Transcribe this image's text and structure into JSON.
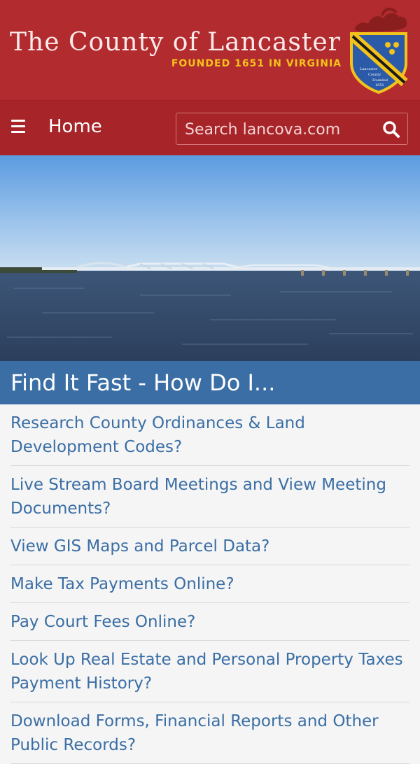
{
  "header": {
    "title": "The County of Lancaster",
    "tagline": "FOUNDED 1651 IN VIRGINIA",
    "crest_text": [
      "Lancaster",
      "County",
      "Founded",
      "1651"
    ],
    "colors": {
      "red": "#b22b2f",
      "gold": "#f3c21b"
    }
  },
  "nav": {
    "home_label": "Home",
    "search_placeholder": "Search lancova.com",
    "menu_icon": "hamburger-menu-icon",
    "search_icon": "magnifier-icon"
  },
  "section": {
    "title": "Find It Fast - How Do I..."
  },
  "links": [
    "Research County Ordinances & Land Development Codes?",
    "Live Stream Board Meetings and View Meeting Documents?",
    "View GIS Maps and Parcel Data?",
    "Make Tax Payments Online?",
    "Pay Court Fees Online?",
    "Look Up Real Estate and Personal Property Taxes Payment History?",
    "Download Forms, Financial Reports and Other Public Records?"
  ]
}
